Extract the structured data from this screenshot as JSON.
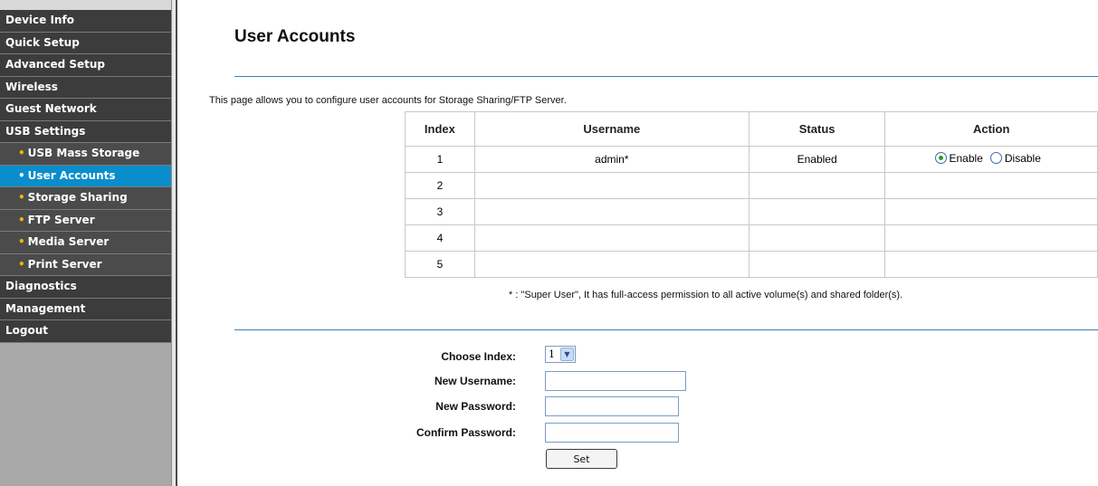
{
  "sidebar": {
    "items": [
      {
        "label": "Device Info",
        "level": "top",
        "active": false
      },
      {
        "label": "Quick Setup",
        "level": "top",
        "active": false
      },
      {
        "label": "Advanced Setup",
        "level": "top",
        "active": false
      },
      {
        "label": "Wireless",
        "level": "top",
        "active": false
      },
      {
        "label": "Guest Network",
        "level": "top",
        "active": false
      },
      {
        "label": "USB Settings",
        "level": "top",
        "active": false
      },
      {
        "label": "USB Mass Storage",
        "level": "sub",
        "active": false
      },
      {
        "label": "User Accounts",
        "level": "sub",
        "active": true
      },
      {
        "label": "Storage Sharing",
        "level": "sub",
        "active": false
      },
      {
        "label": "FTP Server",
        "level": "sub",
        "active": false
      },
      {
        "label": "Media Server",
        "level": "sub",
        "active": false
      },
      {
        "label": "Print Server",
        "level": "sub",
        "active": false
      },
      {
        "label": "Diagnostics",
        "level": "top",
        "active": false
      },
      {
        "label": "Management",
        "level": "top",
        "active": false
      },
      {
        "label": "Logout",
        "level": "top",
        "active": false
      }
    ]
  },
  "main": {
    "title": "User Accounts",
    "description": "This page allows you to configure user accounts for Storage Sharing/FTP Server.",
    "table": {
      "headers": [
        "Index",
        "Username",
        "Status",
        "Action"
      ],
      "rows": [
        {
          "index": "1",
          "username": "admin*",
          "status": "Enabled",
          "action": {
            "enable": "Enable",
            "disable": "Disable",
            "selected": "Enable"
          }
        },
        {
          "index": "2",
          "username": "",
          "status": "",
          "action": null
        },
        {
          "index": "3",
          "username": "",
          "status": "",
          "action": null
        },
        {
          "index": "4",
          "username": "",
          "status": "",
          "action": null
        },
        {
          "index": "5",
          "username": "",
          "status": "",
          "action": null
        }
      ]
    },
    "footnote": "* : \"Super User\", It has full-access permission to all active volume(s) and shared folder(s)."
  },
  "form": {
    "choose_index_label": "Choose Index:",
    "choose_index_value": "1",
    "new_username_label": "New Username:",
    "new_username_value": "",
    "new_password_label": "New Password:",
    "new_password_value": "",
    "confirm_password_label": "Confirm Password:",
    "confirm_password_value": "",
    "set_label": "Set"
  },
  "colors": {
    "menu_top": "#3c3c3c",
    "menu_sub": "#4b4b4b",
    "menu_active": "#0a8ecb",
    "menu_bullet": "#f0b400",
    "divider": "#3c7fb0"
  }
}
